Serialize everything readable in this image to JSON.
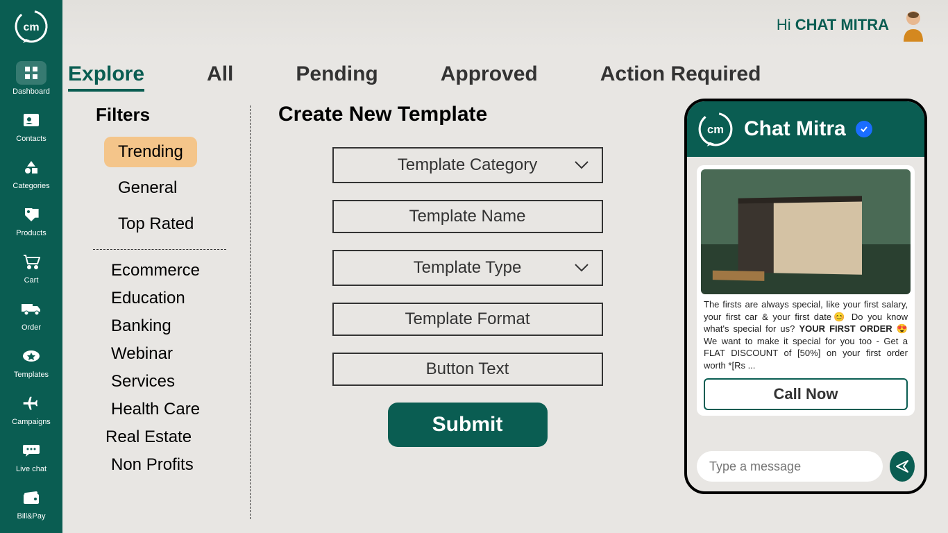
{
  "header": {
    "greeting_prefix": "Hi ",
    "greeting_name": "CHAT MITRA"
  },
  "sidebar": {
    "items": [
      {
        "label": "Dashboard"
      },
      {
        "label": "Contacts"
      },
      {
        "label": "Categories"
      },
      {
        "label": "Products"
      },
      {
        "label": "Cart"
      },
      {
        "label": "Order"
      },
      {
        "label": "Templates"
      },
      {
        "label": "Campaigns"
      },
      {
        "label": "Live chat"
      },
      {
        "label": "Bill&Pay"
      }
    ]
  },
  "tabs": [
    {
      "label": "Explore"
    },
    {
      "label": "All"
    },
    {
      "label": "Pending"
    },
    {
      "label": "Approved"
    },
    {
      "label": "Action Required"
    }
  ],
  "filters": {
    "title": "Filters",
    "primary": [
      {
        "label": "Trending"
      },
      {
        "label": "General"
      },
      {
        "label": "Top Rated"
      }
    ],
    "categories": [
      {
        "label": "Ecommerce"
      },
      {
        "label": "Education"
      },
      {
        "label": "Banking"
      },
      {
        "label": "Webinar"
      },
      {
        "label": "Services"
      },
      {
        "label": "Health Care"
      },
      {
        "label": "Real Estate"
      },
      {
        "label": "Non Profits"
      }
    ]
  },
  "form": {
    "title": "Create New Template",
    "category_placeholder": "Template Category",
    "name_placeholder": "Template Name",
    "type_placeholder": "Template Type",
    "format_placeholder": "Template Format",
    "button_text_placeholder": "Button Text",
    "submit_label": "Submit"
  },
  "preview": {
    "title": "Chat Mitra",
    "message_part1": "The firsts are always special, like your first salary, your first car & your first date",
    "message_part2": " Do you know what's special for us? ",
    "message_bold": "YOUR FIRST ORDER",
    "message_part3": " We want to make it special for you too - Get a FLAT DISCOUNT of [50%] on your first order worth *[Rs ...",
    "call_label": "Call Now",
    "input_placeholder": "Type a message"
  }
}
